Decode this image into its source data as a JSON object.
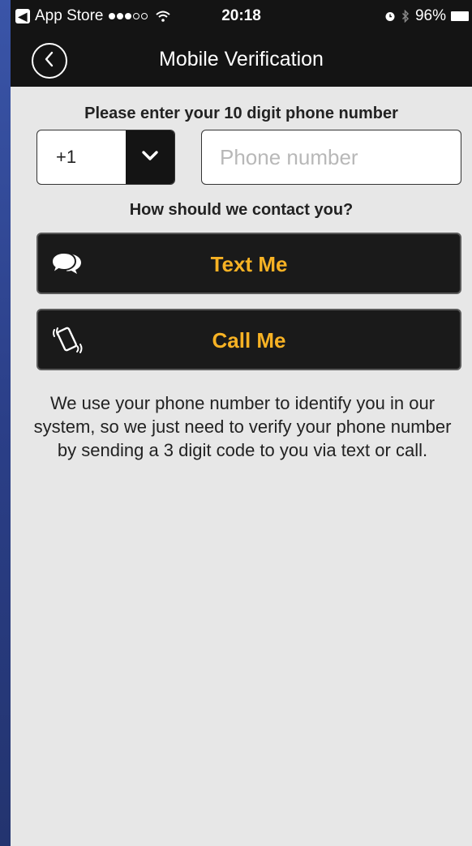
{
  "status_bar": {
    "back_app": "App Store",
    "time": "20:18",
    "battery": "96%",
    "signal_bars_filled": 3,
    "signal_bars_total": 5
  },
  "nav": {
    "title": "Mobile Verification"
  },
  "form": {
    "prompt": "Please enter your 10 digit phone number",
    "country_code": "+1",
    "phone_placeholder": "Phone number",
    "phone_value": "",
    "contact_prompt": "How should we contact you?"
  },
  "buttons": {
    "text_me": "Text Me",
    "call_me": "Call Me"
  },
  "info": "We use your phone number to identify you in our system, so we just need to verify your phone number by sending a 3 digit code to you via text or call.",
  "icons": {
    "back": "chevron-left-icon",
    "dropdown": "chevron-down-icon",
    "text": "chat-bubbles-icon",
    "call": "ringing-phone-icon"
  },
  "colors": {
    "accent": "#f7b224",
    "bar": "#141414",
    "background": "#e7e7e7"
  }
}
